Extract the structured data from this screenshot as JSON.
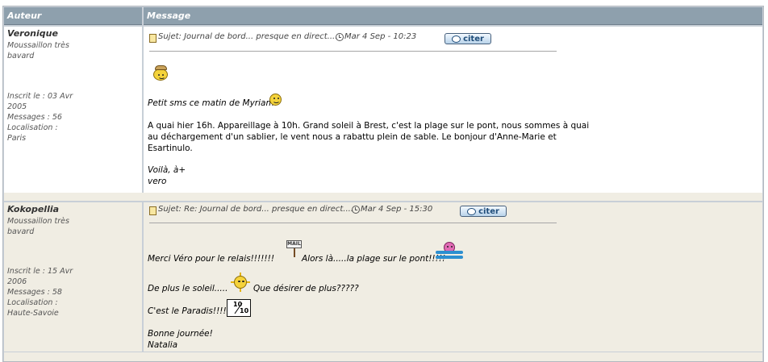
{
  "table": {
    "header_author": "Auteur",
    "header_message": "Message"
  },
  "posts": [
    {
      "author": "Veronique",
      "rank": [
        "Moussaillon très",
        "bavard"
      ],
      "joined": [
        "Inscrit le : 03 Avr",
        "2005"
      ],
      "messages": "Messages : 56",
      "location": [
        "Localisation :",
        "Paris"
      ],
      "subject": "Sujet: Journal de bord... presque en direct....",
      "date": "Mar 4 Sep - 10:23",
      "quote_label": "citer",
      "lines": [
        "Petit sms ce matin de Myriam",
        "A quai hier 16h. Appareillage à 10h. Grand soleil à Brest, c'est la plage sur le pont, nous sommes à quai",
        "au déchargement d'un sablier, le vent nous a rabattu plein de sable. Le bonjour d'Anne-Marie et",
        "Esartinulo.",
        "Voilà, à+",
        "vero"
      ]
    },
    {
      "author": "Kokopellia",
      "rank": [
        "Moussaillon très",
        "bavard"
      ],
      "joined": [
        "Inscrit le : 15 Avr",
        "2006"
      ],
      "messages": "Messages : 58",
      "location": [
        "Localisation :",
        "Haute-Savoie"
      ],
      "subject": "Sujet: Re: Journal de bord... presque en direct....",
      "date": "Mar 4 Sep - 15:30",
      "quote_label": "citer",
      "lines": [
        "Merci Véro pour le relais!!!!!!!",
        "Alors là.....la plage sur le pont!!!!!",
        "De plus le soleil.....",
        "Que désirer de plus?????",
        "C'est le Paradis!!!!!",
        "Bonne journée!",
        "Natalia"
      ],
      "sign_text": "MAIL",
      "rating_top": "10",
      "rating_bottom": "10"
    }
  ],
  "colors": {
    "header_bg": "#8ea0ad",
    "row_alt_bg": "#f0ede3",
    "border": "#c8cfd7"
  }
}
